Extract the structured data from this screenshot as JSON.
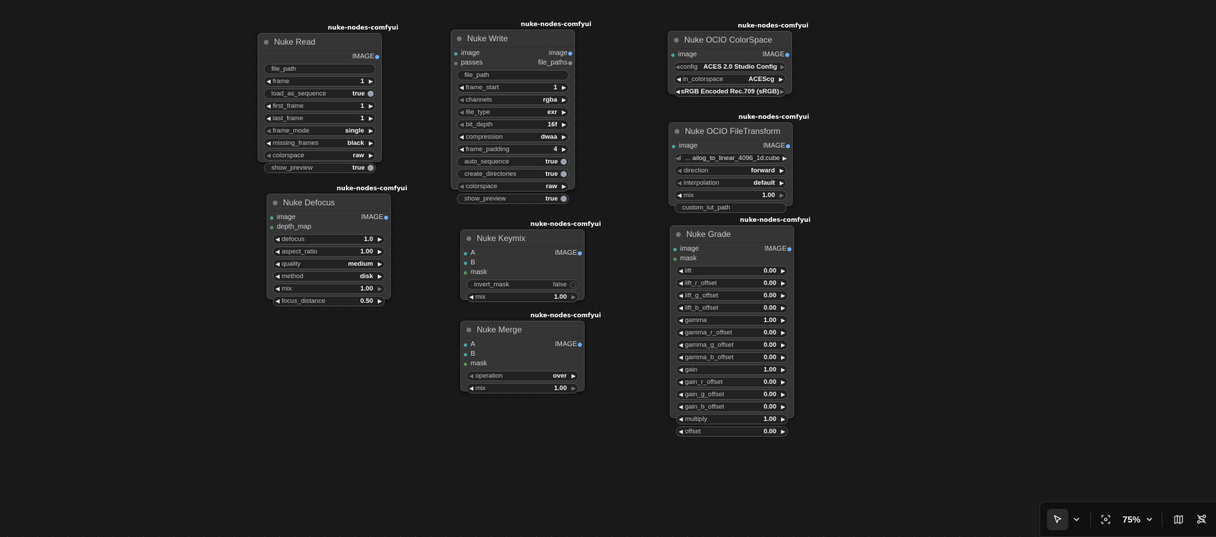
{
  "pack": "nuke-nodes-comfyui",
  "nodes": {
    "read": {
      "title": "Nuke Read",
      "output": "IMAGE",
      "file_path": "file_path",
      "frame_label": "frame",
      "frame_value": "1",
      "load_seq_label": "load_as_sequence",
      "load_seq_value": "true",
      "first_frame_label": "first_frame",
      "first_frame_value": "1",
      "last_frame_label": "last_frame",
      "last_frame_value": "1",
      "frame_mode_label": "frame_mode",
      "frame_mode_value": "single",
      "missing_label": "missing_frames",
      "missing_value": "black",
      "colorspace_label": "colorspace",
      "colorspace_value": "raw",
      "preview_label": "show_preview",
      "preview_value": "true"
    },
    "write": {
      "title": "Nuke Write",
      "in_image": "image",
      "out_image": "image",
      "in_passes": "passes",
      "out_file_paths": "file_paths",
      "file_path": "file_path",
      "frame_start_label": "frame_start",
      "frame_start_value": "1",
      "channels_label": "channels",
      "channels_value": "rgba",
      "file_type_label": "file_type",
      "file_type_value": "exr",
      "bit_depth_label": "bit_depth",
      "bit_depth_value": "16f",
      "compression_label": "compression",
      "compression_value": "dwaa",
      "padding_label": "frame_padding",
      "padding_value": "4",
      "auto_seq_label": "auto_sequence",
      "auto_seq_value": "true",
      "create_dirs_label": "create_directories",
      "create_dirs_value": "true",
      "colorspace_label": "colorspace",
      "colorspace_value": "raw",
      "preview_label": "show_preview",
      "preview_value": "true"
    },
    "colorspace": {
      "title": "Nuke OCIO ColorSpace",
      "in_image": "image",
      "output": "IMAGE",
      "config_label": "config",
      "config_value": "ACES 2.0 Studio Config",
      "in_cs_label": "in_colorspace",
      "in_cs_value": "ACEScg",
      "out_cs_value": "sRGB Encoded Rec.709 (sRGB)"
    },
    "filetransform": {
      "title": "Nuke OCIO FileTransform",
      "in_image": "image",
      "output": "IMAGE",
      "file_label": "l",
      "file_value": "... ailog_to_linear_4096_1d.cube",
      "direction_label": "direction",
      "direction_value": "forward",
      "interp_label": "interpolation",
      "interp_value": "default",
      "mix_label": "mix",
      "mix_value": "1.00",
      "custom_lut": "custom_lut_path"
    },
    "defocus": {
      "title": "Nuke Defocus",
      "in_image": "image",
      "in_depth": "depth_map",
      "output": "IMAGE",
      "defocus_label": "defocus",
      "defocus_value": "1.0",
      "aspect_label": "aspect_ratio",
      "aspect_value": "1.00",
      "quality_label": "quality",
      "quality_value": "medium",
      "method_label": "method",
      "method_value": "disk",
      "mix_label": "mix",
      "mix_value": "1.00",
      "focus_label": "focus_distance",
      "focus_value": "0.50"
    },
    "keymix": {
      "title": "Nuke Keymix",
      "in_a": "A",
      "in_b": "B",
      "in_mask": "mask",
      "output": "IMAGE",
      "invert_label": "invert_mask",
      "invert_value": "false",
      "mix_label": "mix",
      "mix_value": "1.00"
    },
    "merge": {
      "title": "Nuke Merge",
      "in_a": "A",
      "in_b": "B",
      "in_mask": "mask",
      "output": "IMAGE",
      "op_label": "operation",
      "op_value": "over",
      "mix_label": "mix",
      "mix_value": "1.00"
    },
    "grade": {
      "title": "Nuke Grade",
      "in_image": "image",
      "in_mask": "mask",
      "output": "IMAGE",
      "params": [
        {
          "label": "lift",
          "value": "0.00"
        },
        {
          "label": "lift_r_offset",
          "value": "0.00"
        },
        {
          "label": "lift_g_offset",
          "value": "0.00"
        },
        {
          "label": "lift_b_offset",
          "value": "0.00"
        },
        {
          "label": "gamma",
          "value": "1.00"
        },
        {
          "label": "gamma_r_offset",
          "value": "0.00"
        },
        {
          "label": "gamma_g_offset",
          "value": "0.00"
        },
        {
          "label": "gamma_b_offset",
          "value": "0.00"
        },
        {
          "label": "gain",
          "value": "1.00"
        },
        {
          "label": "gain_r_offset",
          "value": "0.00"
        },
        {
          "label": "gain_g_offset",
          "value": "0.00"
        },
        {
          "label": "gain_b_offset",
          "value": "0.00"
        },
        {
          "label": "multiply",
          "value": "1.00"
        },
        {
          "label": "offset",
          "value": "0.00"
        }
      ]
    }
  },
  "toolbar": {
    "select_icon": "pointer-icon",
    "zoom": "75%",
    "colors": {
      "accent_output": "#6ab0ff",
      "input_slot": "#4aa3a0"
    }
  }
}
